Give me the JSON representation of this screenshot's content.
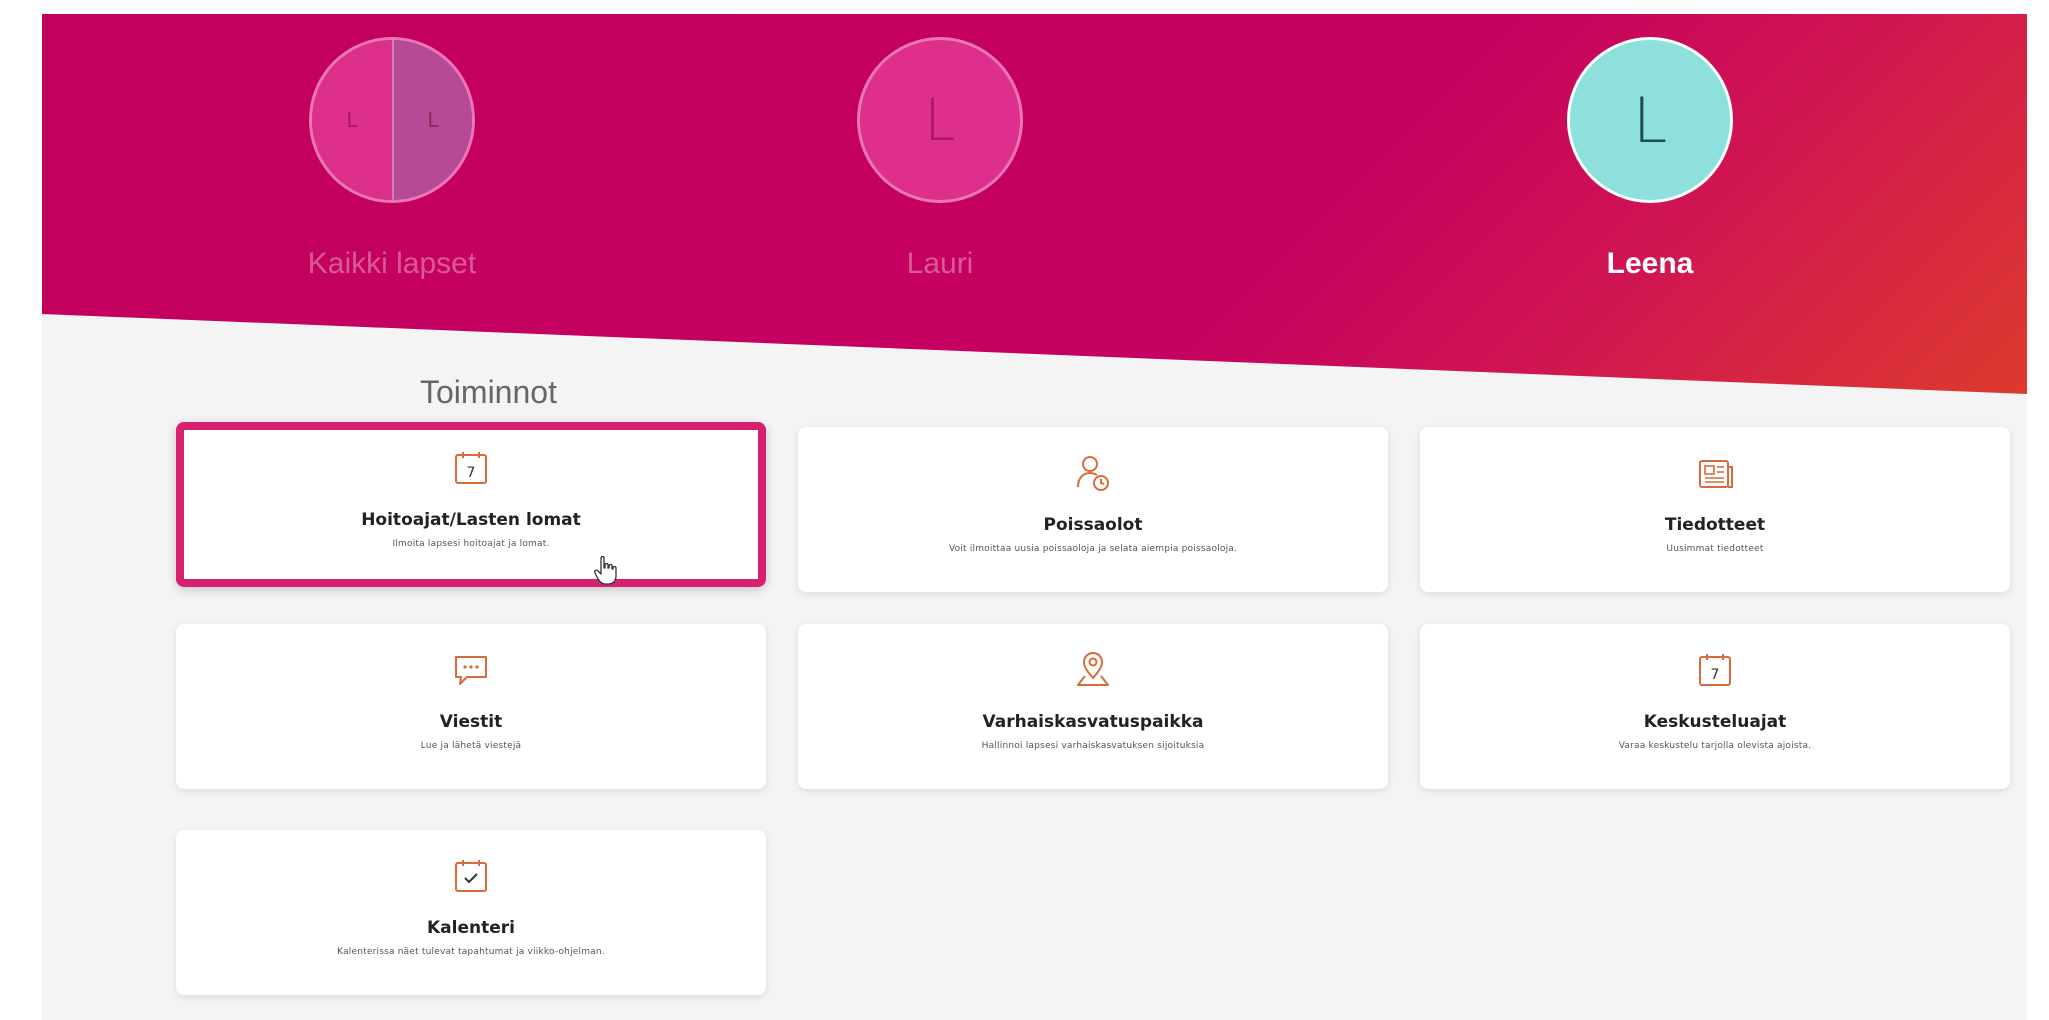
{
  "children": [
    {
      "name": "Kaikki lapset",
      "initials": [
        "L",
        "L"
      ],
      "active": false
    },
    {
      "name": "Lauri",
      "initial": "L",
      "active": false
    },
    {
      "name": "Leena",
      "initial": "L",
      "active": true
    }
  ],
  "section_title": "Toiminnot",
  "cards": [
    {
      "title": "Hoitoajat/Lasten lomat",
      "description": "Ilmoita lapsesi hoitoajat ja lomat.",
      "icon": "calendar-7-icon",
      "selected": true
    },
    {
      "title": "Poissaolot",
      "description": "Voit ilmoittaa uusia poissaoloja ja selata aiempia poissaoloja.",
      "icon": "person-clock-icon",
      "selected": false
    },
    {
      "title": "Tiedotteet",
      "description": "Uusimmat tiedotteet",
      "icon": "newspaper-icon",
      "selected": false
    },
    {
      "title": "Viestit",
      "description": "Lue ja lähetä viestejä",
      "icon": "chat-bubble-icon",
      "selected": false
    },
    {
      "title": "Varhaiskasvatuspaikka",
      "description": "Hallinnoi lapsesi varhaiskasvatuksen sijoituksia",
      "icon": "location-pin-icon",
      "selected": false
    },
    {
      "title": "Keskusteluajat",
      "description": "Varaa keskustelu tarjolla olevista ajoista.",
      "icon": "calendar-7-icon",
      "selected": false
    },
    {
      "title": "Kalenteri",
      "description": "Kalenterissa näet tulevat tapahtumat ja viikko-ohjelman.",
      "icon": "calendar-check-icon",
      "selected": false
    }
  ],
  "colors": {
    "brand": "#c4005f",
    "accent_orange": "#dd3a2d",
    "selected_border": "#d7206e",
    "active_avatar": "#8ee0dc",
    "icon": "#d96a3a"
  }
}
